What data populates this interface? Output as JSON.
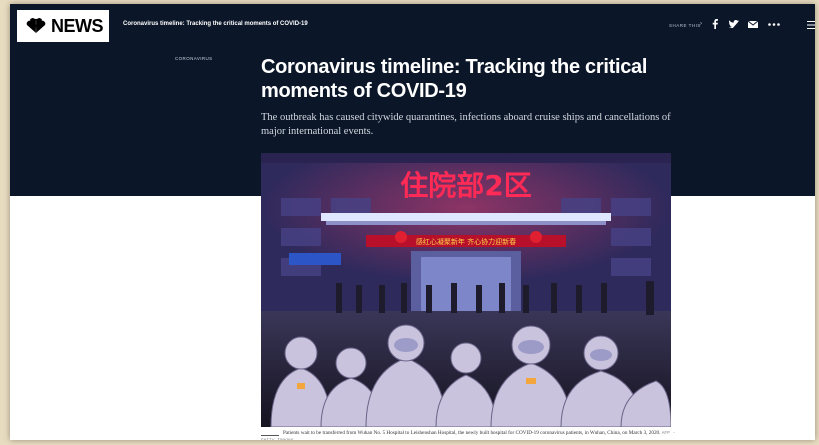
{
  "topbar": {
    "logo_text": "NEWS",
    "title": "Coronavirus timeline: Tracking the critical moments of COVID-19",
    "share_label": "SHARE THIS",
    "share_chevron": "›",
    "icons": [
      "facebook-icon",
      "twitter-icon",
      "email-icon",
      "more-icon",
      "menu-icon"
    ]
  },
  "article": {
    "category": "CORONAVIRUS",
    "headline": "Coronavirus timeline: Tracking the critical moments of COVID-19",
    "dek": "The outbreak has caused citywide quarantines, infections aboard cruise ships and cancellations of major international events."
  },
  "photo": {
    "sign_text": "住院部2区",
    "banner_text": "感红心凝聚新年  齐心协力迎新春",
    "side_sign_text": "住院部2区"
  },
  "caption": {
    "text": "Patients wait to be transferred from Wuhan No. 5 Hospital to Leishenshan Hospital, the newly built hospital for COVID-19 coronavirus patients, in Wuhan, China, on March 3, 2020.",
    "credit": "AFP - Getty Images"
  },
  "colors": {
    "navy": "#0b1729",
    "sign_red": "#ff2a55",
    "background": "#e8dcc0"
  }
}
